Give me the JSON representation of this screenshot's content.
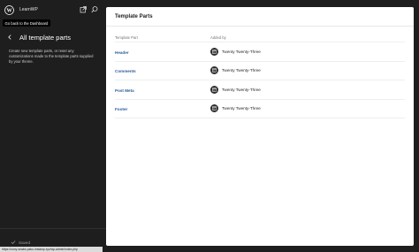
{
  "site": {
    "name": "LearnWP"
  },
  "tooltip": "Go back to the Dashboard",
  "sidebar": {
    "title": "All template parts",
    "description": "Create new template parts, or reset any customizations made to the template parts supplied by your theme.",
    "footer": {
      "saved_label": "Saved"
    }
  },
  "panel": {
    "title": "Template Parts",
    "columns": [
      "Template Part",
      "Added by"
    ],
    "rows": [
      {
        "name": "Header",
        "added_by": "Twenty Twenty-Three"
      },
      {
        "name": "Comments",
        "added_by": "Twenty Twenty-Three"
      },
      {
        "name": "Post Meta",
        "added_by": "Twenty Twenty-Three"
      },
      {
        "name": "Footer",
        "added_by": "Twenty Twenty-Three"
      }
    ]
  },
  "statusbar": {
    "url": "https://ooxy-snake-paku-instawp.xyz/wp-admin/index.php"
  },
  "icons": {
    "logo": "wordpress-logo-icon",
    "view": "external-view-icon",
    "search": "search-icon",
    "back": "chevron-left-icon",
    "saved": "checkmark-icon",
    "theme": "theme-layout-icon"
  },
  "colors": {
    "sidebar_bg": "#1e1e1e",
    "panel_bg": "#ffffff",
    "link": "#2c5d9c"
  }
}
